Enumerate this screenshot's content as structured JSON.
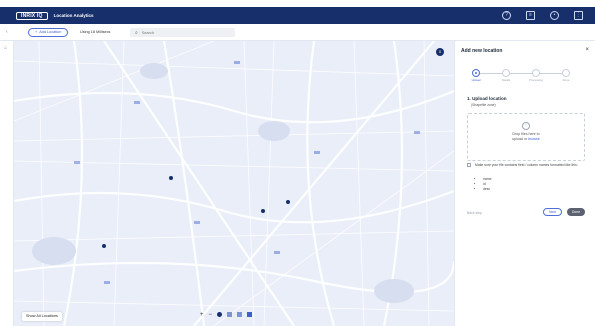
{
  "header": {
    "logo_text": "INRIX IQ",
    "app_title": "Location Analytics",
    "icons": [
      "help-icon",
      "document-icon",
      "user-icon",
      "apps-icon"
    ]
  },
  "toolbar": {
    "collapse_icon": "chevron-left-icon",
    "add_location_label": "Add Location",
    "using_label": "Using 18 Millisecs",
    "search_placeholder": "Search"
  },
  "map": {
    "badge_text": "0",
    "show_all_label": "Show All Locations",
    "controls": {
      "zoom_in": "+",
      "zoom_out": "−"
    },
    "colors": {
      "background": "#e9eef8",
      "roads": "#ffffff",
      "marker": "#17306b"
    }
  },
  "panel": {
    "title": "Add new location",
    "close_label": "×",
    "steps": [
      {
        "label": "Upload",
        "active": true
      },
      {
        "label": "Details",
        "active": false
      },
      {
        "label": "Processing",
        "active": false
      },
      {
        "label": "Done",
        "active": false
      }
    ],
    "section_title": "1. Upload location",
    "section_subtitle": "(Shapefile zone)",
    "dropzone": {
      "line1": "Drop files here to",
      "line2_prefix": "upload or ",
      "browse_link": "browse"
    },
    "note": {
      "text": "Make sure your file contains field / column names formatted like this:",
      "items": [
        "name",
        "id",
        "desc"
      ]
    },
    "back_label": "Back step",
    "next_label": "Next",
    "done_label": "Done"
  },
  "accent_colors": {
    "brand_navy": "#17306b",
    "accent_blue": "#3f5fcf"
  }
}
